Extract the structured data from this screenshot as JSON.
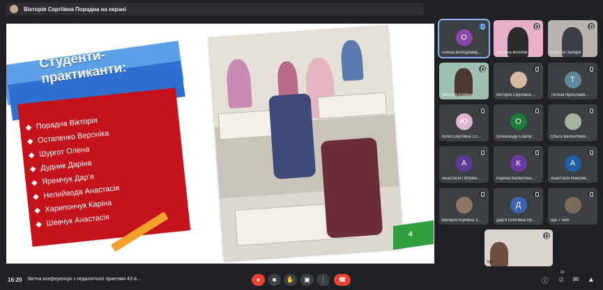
{
  "presentation_bar": {
    "text": "Вікторія Сергіївна Порадна на екрані"
  },
  "slide": {
    "title": "Студенти-практиканти:",
    "students": [
      "Порадна Вікторія",
      "Остапенко Вероніка",
      "Шургот Олена",
      "Дудник Даріна",
      "Яремчук Дар’я",
      "Непийвода Анастасія",
      "Харипончук Каріна",
      "Шевчук Анастасія"
    ],
    "page_number": "4"
  },
  "participants": [
    {
      "name": "Олена Володимир...",
      "initial": "О",
      "color": "#8e44ad",
      "speaking": true,
      "photo": false
    },
    {
      "name": "Марина Віталіїв...",
      "initial": "",
      "color": "#e8b0c8",
      "speaking": false,
      "photo": true
    },
    {
      "name": "Олексій Заперв",
      "initial": "",
      "color": "#b9b4ae",
      "speaking": false,
      "photo": true
    },
    {
      "name": "Вікторія Ігорівна",
      "initial": "",
      "color": "#b0a094",
      "speaking": false,
      "photo": true
    },
    {
      "name": "Вікторія Сергіївна ...",
      "initial": "",
      "color": "#d8b9a4",
      "speaking": false,
      "photo": true
    },
    {
      "name": "Тетяна Ярославів...",
      "initial": "Т",
      "color": "#5f8a9e",
      "speaking": false,
      "photo": false
    },
    {
      "name": "Юлія Сергіївна Сл...",
      "initial": "Ю",
      "color": "#e1b4d6",
      "speaking": false,
      "photo": false
    },
    {
      "name": "Олександр Сергій...",
      "initial": "О",
      "color": "#1e7d3c",
      "speaking": false,
      "photo": false
    },
    {
      "name": "Ольга Валентинів...",
      "initial": "",
      "color": "#a7b29a",
      "speaking": false,
      "photo": true
    },
    {
      "name": "Анастасія Петрівн...",
      "initial": "А",
      "color": "#5b3a96",
      "speaking": false,
      "photo": false
    },
    {
      "name": "Карина Валентині...",
      "initial": "К",
      "color": "#6a3aa0",
      "speaking": false,
      "photo": false
    },
    {
      "name": "Анастасія Максим...",
      "initial": "А",
      "color": "#1f5fa8",
      "speaking": false,
      "photo": false
    },
    {
      "name": "Валерія Юріївна З...",
      "initial": "",
      "color": "#8f7566",
      "speaking": false,
      "photo": true
    },
    {
      "name": "Дар’я Олегівна Яр...",
      "initial": "Д",
      "color": "#3d62b3",
      "speaking": false,
      "photo": false
    },
    {
      "name": "Ще 7 осіб",
      "initial": "",
      "color": "#7a6a5a",
      "speaking": false,
      "photo": true
    }
  ],
  "self_view": {
    "name": "Ви"
  },
  "bottom_bar": {
    "time": "16:20",
    "meeting_title": "Звітна конференція з педагогічної практики 43-4...",
    "participants_count": "22"
  },
  "colors": {
    "accent": "#8ab4f8",
    "danger": "#ea4335",
    "slide_red": "#c4131a",
    "slide_blue": "#2f6fd0",
    "page_green": "#2e9e3e"
  },
  "icons": {
    "mic_off": "mic-off-icon",
    "camera": "camera-icon",
    "raise_hand": "hand-icon",
    "present": "present-icon",
    "more": "more-vert-icon",
    "hangup": "call-end-icon",
    "info": "info-icon",
    "people": "people-icon",
    "chat": "chat-icon",
    "activities": "activities-icon"
  }
}
